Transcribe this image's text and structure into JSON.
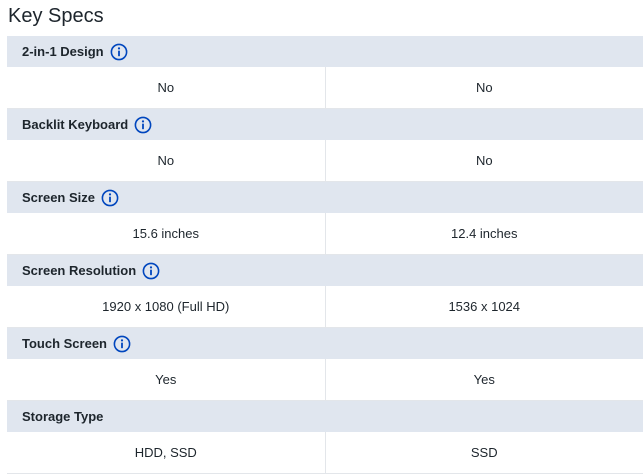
{
  "section": {
    "title": "Key Specs"
  },
  "specs": [
    {
      "label": "2-in-1 Design",
      "has_info": true,
      "values": [
        "No",
        "No"
      ]
    },
    {
      "label": "Backlit Keyboard",
      "has_info": true,
      "values": [
        "No",
        "No"
      ]
    },
    {
      "label": "Screen Size",
      "has_info": true,
      "values": [
        "15.6 inches",
        "12.4 inches"
      ]
    },
    {
      "label": "Screen Resolution",
      "has_info": true,
      "values": [
        "1920 x 1080 (Full HD)",
        "1536 x 1024"
      ]
    },
    {
      "label": "Touch Screen",
      "has_info": true,
      "values": [
        "Yes",
        "Yes"
      ]
    },
    {
      "label": "Storage Type",
      "has_info": false,
      "values": [
        "HDD, SSD",
        "SSD"
      ]
    }
  ],
  "icons": {
    "info": "info-icon"
  },
  "colors": {
    "header_bg": "#e0e6ef",
    "info_icon": "#0046be",
    "divider": "#e3e6ea",
    "text": "#1d252c"
  }
}
